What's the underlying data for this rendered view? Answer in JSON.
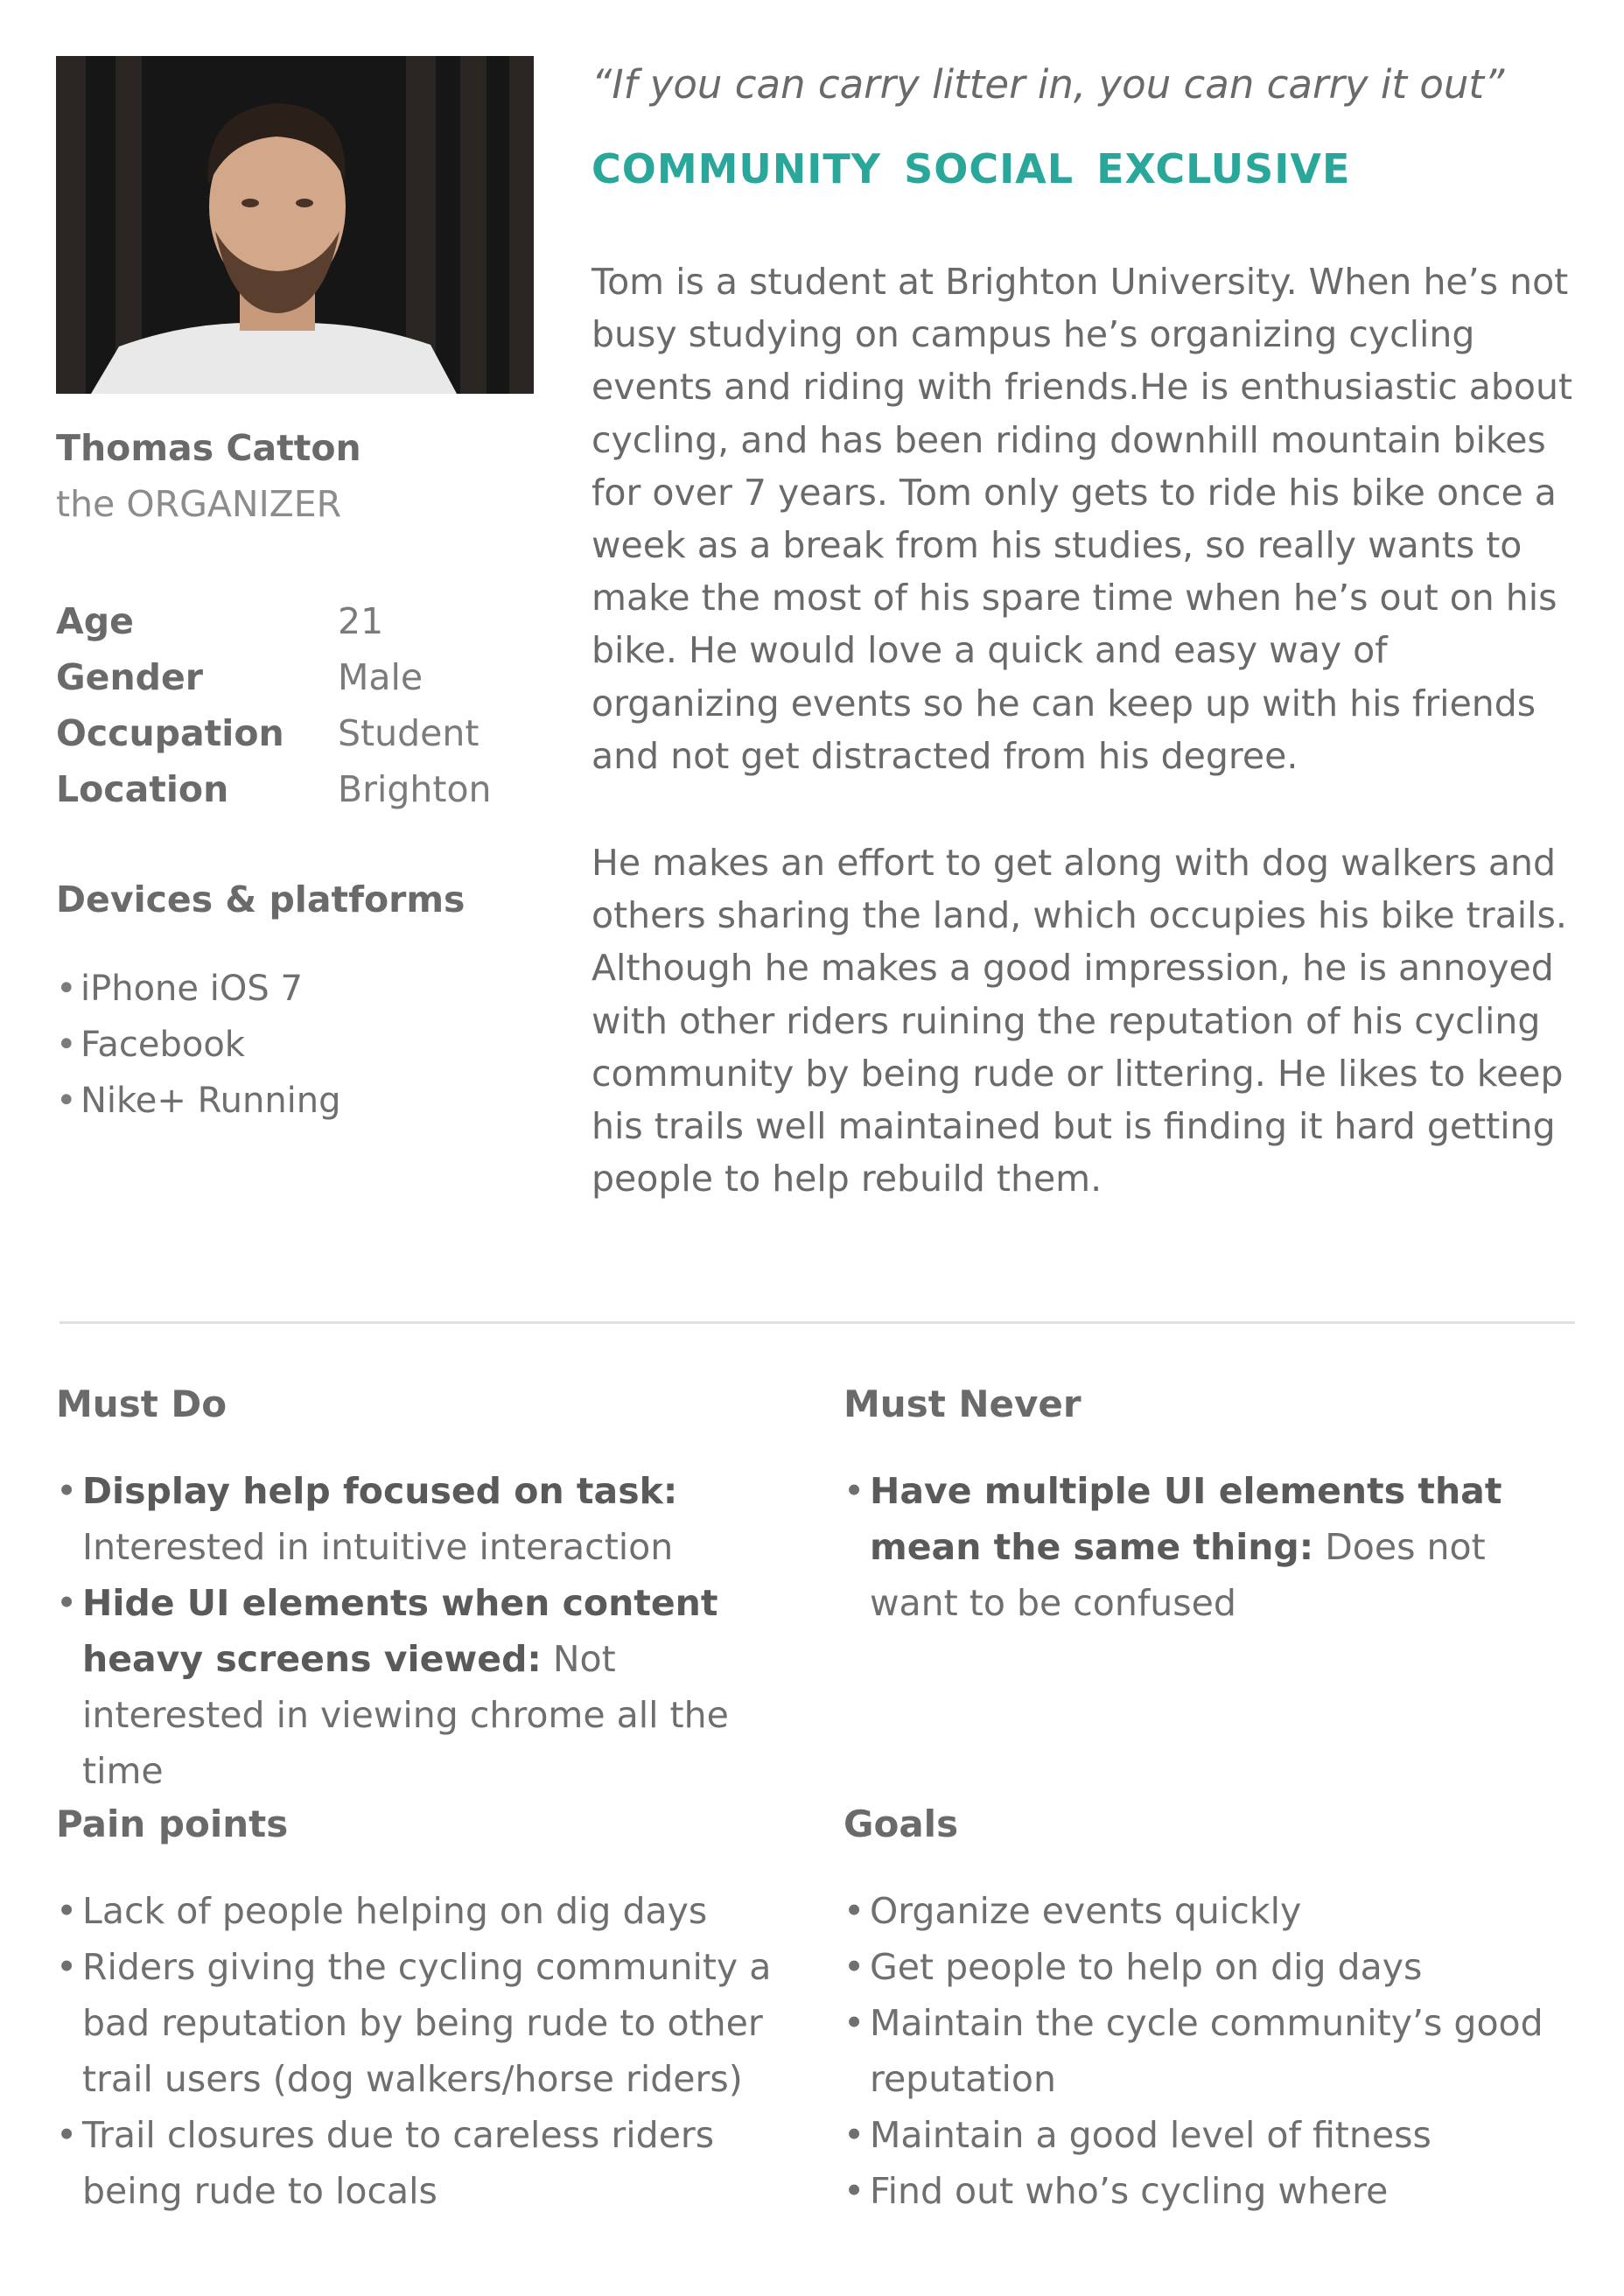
{
  "persona": {
    "name": "Thomas Catton",
    "role": "the ORGANIZER",
    "quote": "“If you can carry litter in, you can carry it out”",
    "tags": [
      "COMMUNITY",
      "SOCIAL",
      "EXCLUSIVE"
    ],
    "facts": [
      {
        "label": "Age",
        "value": "21"
      },
      {
        "label": "Gender",
        "value": "Male"
      },
      {
        "label": "Occupation",
        "value": "Student"
      },
      {
        "label": "Location",
        "value": "Brighton"
      }
    ],
    "devices_title": "Devices & platforms",
    "devices": [
      "iPhone iOS 7",
      "Facebook",
      "Nike+ Running"
    ],
    "bio": [
      "Tom is a student at Brighton University. When he’s not busy studying on campus he’s organizing cycling events and riding with friends.He is enthusiastic about cycling, and has been riding downhill mountain bikes for over 7 years. Tom only gets to ride his bike once a week as a break from his studies, so really wants to make the most of his spare time when he’s out on his bike. He would love a quick and easy way of organizing events so he can keep up with his friends and not get distracted from his degree.",
      "He makes an effort to get along with dog walkers and others sharing the land, which occupies his bike trails. Although he makes a good impression, he is annoyed with other riders ruining the reputation of his cycling community by being rude or littering. He likes to keep his trails well maintained but is finding it hard getting people to help rebuild them."
    ]
  },
  "must_do": {
    "title": "Must Do",
    "items": [
      {
        "bold": "Display help focused on task:",
        "text": "Interested in intuitive interaction"
      },
      {
        "bold": "Hide UI elements when content heavy screens viewed:",
        "text": "Not interested in viewing chrome all the time"
      }
    ]
  },
  "must_never": {
    "title": "Must Never",
    "items": [
      {
        "bold": "Have multiple UI elements that mean the same thing:",
        "text": "Does not want to be confused"
      }
    ]
  },
  "pain_points": {
    "title": "Pain points",
    "items": [
      "Lack of people helping on dig days",
      "Riders giving the cycling community a bad reputation by being rude to other trail users (dog walkers/horse riders)",
      "Trail closures due to careless riders being rude to locals"
    ]
  },
  "goals": {
    "title": "Goals",
    "items": [
      "Organize events quickly",
      "Get people to help on dig days",
      "Maintain the cycle community’s good reputation",
      "Maintain a good level of fitness",
      "Find out who’s cycling where"
    ]
  },
  "colors": {
    "accent": "#2aa79b",
    "text": "#6f6f6f",
    "divider": "#e0e0e0"
  }
}
